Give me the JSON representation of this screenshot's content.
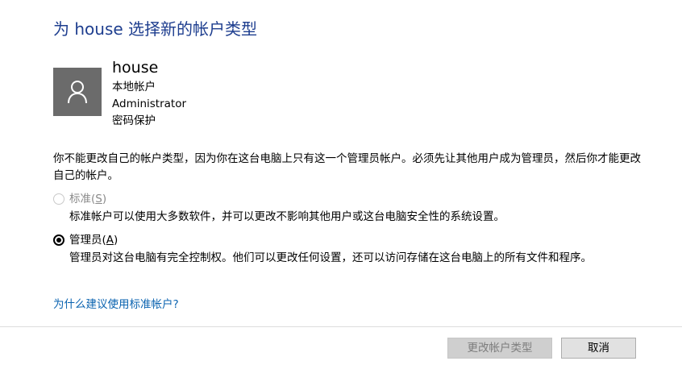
{
  "dialog": {
    "title": "为 house 选择新的帐户类型"
  },
  "account": {
    "name": "house",
    "type": "本地帐户",
    "group": "Administrator",
    "protection": "密码保护",
    "avatar_icon": "user-icon"
  },
  "message": "你不能更改自己的帐户类型，因为你在这台电脑上只有这一个管理员帐户。必须先让其他用户成为管理员，然后你才能更改自己的帐户。",
  "options": {
    "standard": {
      "label": "标准",
      "access_key_open": "(",
      "access_key": "S",
      "access_key_close": ")",
      "description": "标准帐户可以使用大多数软件，并可以更改不影响其他用户或这台电脑安全性的系统设置。",
      "checked": false,
      "enabled": false
    },
    "admin": {
      "label": "管理员",
      "access_key_open": "(",
      "access_key": "A",
      "access_key_close": ")",
      "description": "管理员对这台电脑有完全控制权。他们可以更改任何设置，还可以访问存储在这台电脑上的所有文件和程序。",
      "checked": true,
      "enabled": true
    }
  },
  "help_link": "为什么建议使用标准帐户?",
  "buttons": {
    "change": "更改帐户类型",
    "cancel": "取消"
  },
  "colors": {
    "title": "#1e3e8f",
    "link": "#0a63b0",
    "avatar_bg": "#6b6b6b",
    "disabled_text": "#8a8a8a"
  }
}
